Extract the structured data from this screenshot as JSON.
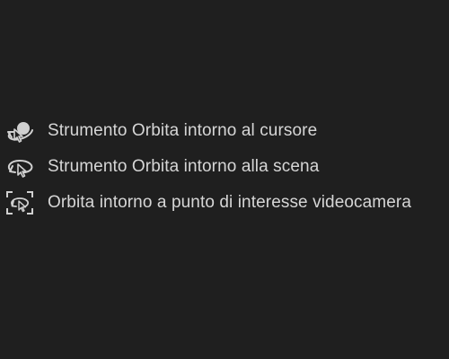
{
  "menu": {
    "items": [
      {
        "label": "Strumento Orbita intorno al cursore",
        "icon": "orbit-around-cursor-icon"
      },
      {
        "label": "Strumento Orbita intorno alla scena",
        "icon": "orbit-around-scene-icon"
      },
      {
        "label": "Orbita intorno a punto di interesse videocamera",
        "icon": "orbit-camera-poi-icon"
      }
    ]
  },
  "colors": {
    "background": "#1f1f1f",
    "text": "#d6d6d6",
    "icon": "#d0d0d0"
  }
}
